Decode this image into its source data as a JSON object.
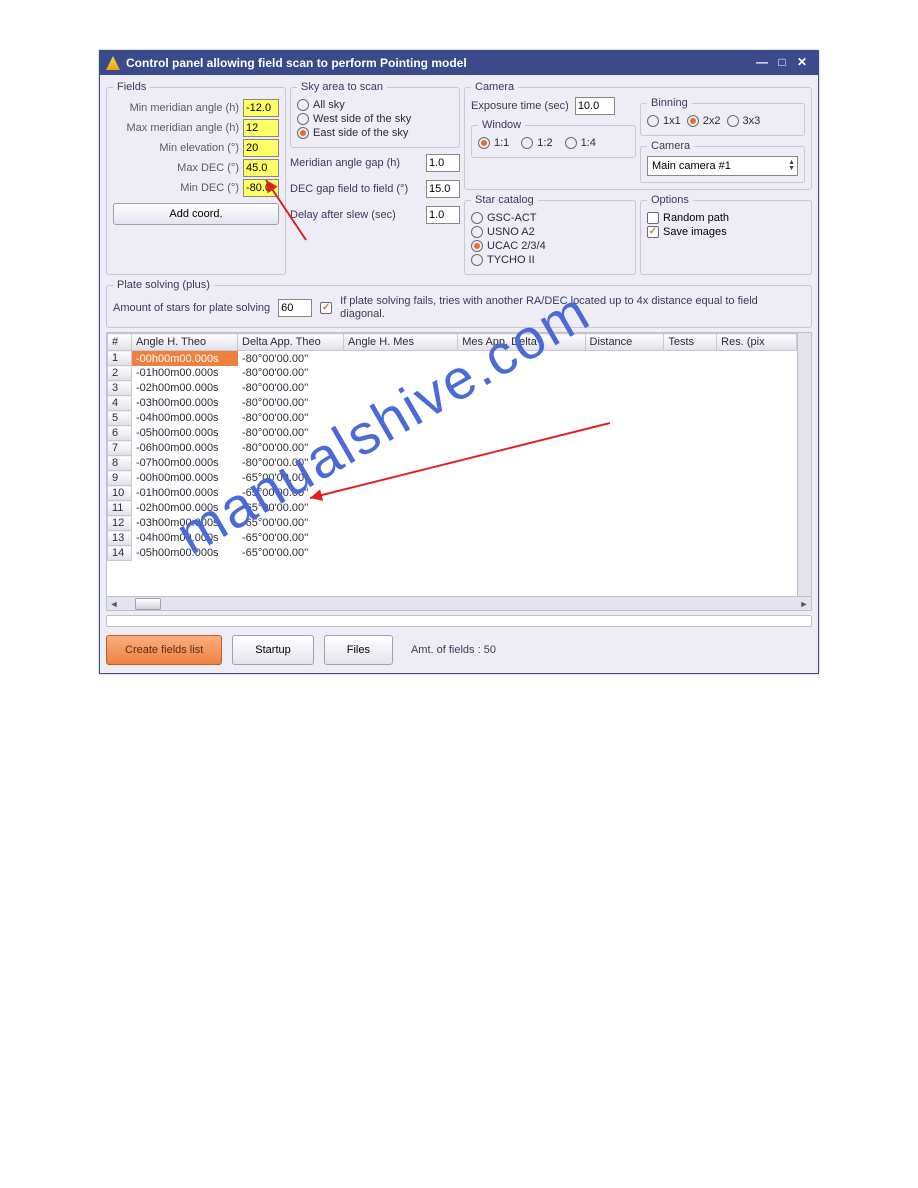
{
  "titlebar": {
    "title": "Control panel allowing field scan to perform Pointing model"
  },
  "fields": {
    "legend": "Fields",
    "minMerLabel": "Min meridian angle (h)",
    "minMer": "-12.0",
    "maxMerLabel": "Max meridian angle (h)",
    "maxMer": "12",
    "minElLabel": "Min elevation (°)",
    "minEl": "20",
    "maxDecLabel": "Max DEC (°)",
    "maxDec": "45.0",
    "minDecLabel": "Min DEC (°)",
    "minDec": "-80.0",
    "addCoord": "Add coord."
  },
  "sky": {
    "legend": "Sky area to scan",
    "allSky": "All sky",
    "west": "West side of the sky",
    "east": "East side of the sky",
    "merGapLabel": "Meridian angle gap (h)",
    "merGap": "1.0",
    "decGapLabel": "DEC gap field to field (°)",
    "decGap": "15.0",
    "delayLabel": "Delay after slew (sec)",
    "delay": "1.0"
  },
  "camera": {
    "legend": "Camera",
    "expLabel": "Exposure time (sec)",
    "exp": "10.0",
    "binLegend": "Binning",
    "b1": "1x1",
    "b2": "2x2",
    "b3": "3x3",
    "winLegend": "Window",
    "w1": "1:1",
    "w2": "1:2",
    "w3": "1:4",
    "camLegend": "Camera",
    "camSel": "Main camera #1"
  },
  "catalog": {
    "legend": "Star catalog",
    "gsc": "GSC-ACT",
    "usno": "USNO A2",
    "ucac": "UCAC 2/3/4",
    "tycho": "TYCHO II"
  },
  "options": {
    "legend": "Options",
    "random": "Random path",
    "save": "Save images"
  },
  "plate": {
    "legend": "Plate solving (plus)",
    "starsLabel": "Amount of stars for plate solving",
    "stars": "60",
    "hint": "If plate solving fails, tries with another RA/DEC located up to 4x distance equal to field diagonal."
  },
  "table": {
    "headers": [
      "#",
      "Angle H. Theo",
      "Delta App. Theo",
      "Angle H. Mes",
      "Mes App. Delta",
      "Distance",
      "Tests",
      "Res. (pix"
    ],
    "rows": [
      {
        "n": "1",
        "a": "-00h00m00.000s",
        "d": "-80°00'00.00''",
        "sel": true
      },
      {
        "n": "2",
        "a": "-01h00m00.000s",
        "d": "-80°00'00.00''"
      },
      {
        "n": "3",
        "a": "-02h00m00.000s",
        "d": "-80°00'00.00''"
      },
      {
        "n": "4",
        "a": "-03h00m00.000s",
        "d": "-80°00'00.00''"
      },
      {
        "n": "5",
        "a": "-04h00m00.000s",
        "d": "-80°00'00.00''"
      },
      {
        "n": "6",
        "a": "-05h00m00.000s",
        "d": "-80°00'00.00''"
      },
      {
        "n": "7",
        "a": "-06h00m00.000s",
        "d": "-80°00'00.00''"
      },
      {
        "n": "8",
        "a": "-07h00m00.000s",
        "d": "-80°00'00.00''"
      },
      {
        "n": "9",
        "a": "-00h00m00.000s",
        "d": "-65°00'00.00''"
      },
      {
        "n": "10",
        "a": "-01h00m00.000s",
        "d": "-65°00'00.00''"
      },
      {
        "n": "11",
        "a": "-02h00m00.000s",
        "d": "-65°00'00.00''"
      },
      {
        "n": "12",
        "a": "-03h00m00.000s",
        "d": "-65°00'00.00''"
      },
      {
        "n": "13",
        "a": "-04h00m00.000s",
        "d": "-65°00'00.00''"
      },
      {
        "n": "14",
        "a": "-05h00m00.000s",
        "d": "-65°00'00.00''"
      }
    ]
  },
  "bottom": {
    "create": "Create fields list",
    "startup": "Startup",
    "files": "Files",
    "amt": "Amt. of fields :  50"
  },
  "watermark": "manualshive.com"
}
